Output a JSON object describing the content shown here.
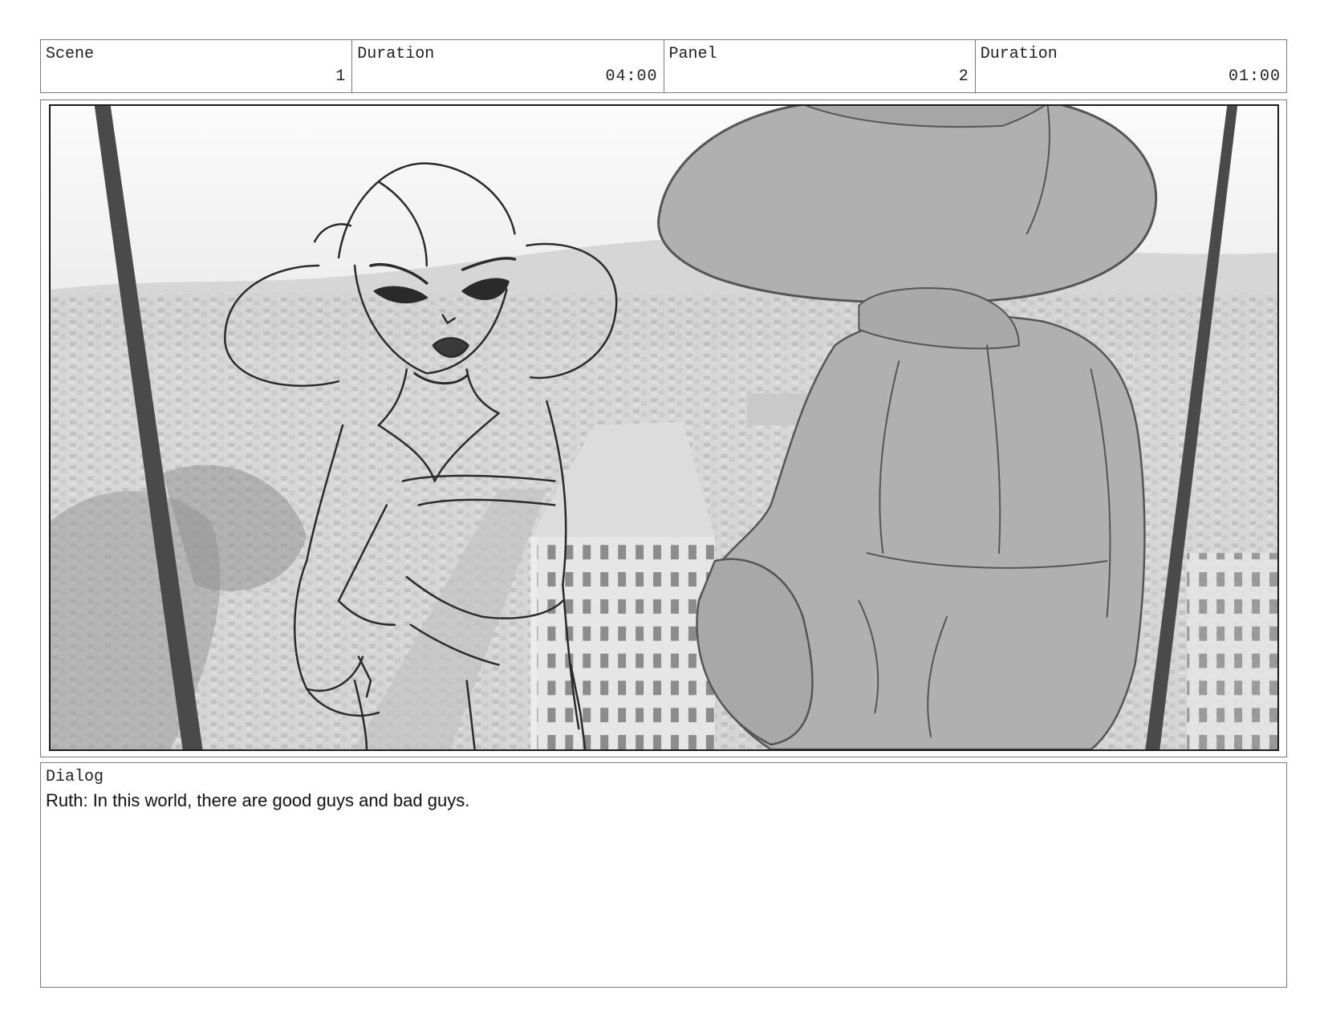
{
  "header": {
    "scene_label": "Scene",
    "scene_value": "1",
    "scene_duration_label": "Duration",
    "scene_duration_value": "04:00",
    "panel_label": "Panel",
    "panel_value": "2",
    "panel_duration_label": "Duration",
    "panel_duration_value": "01:00"
  },
  "dialog": {
    "label": "Dialog",
    "text": "Ruth: In this world, there are good guys and bad guys."
  },
  "colors": {
    "border": "#7a7a7a",
    "sketch_line": "#2a2a2a",
    "silhouette": "#b0b0b0",
    "pillar": "#4a4a4a"
  }
}
